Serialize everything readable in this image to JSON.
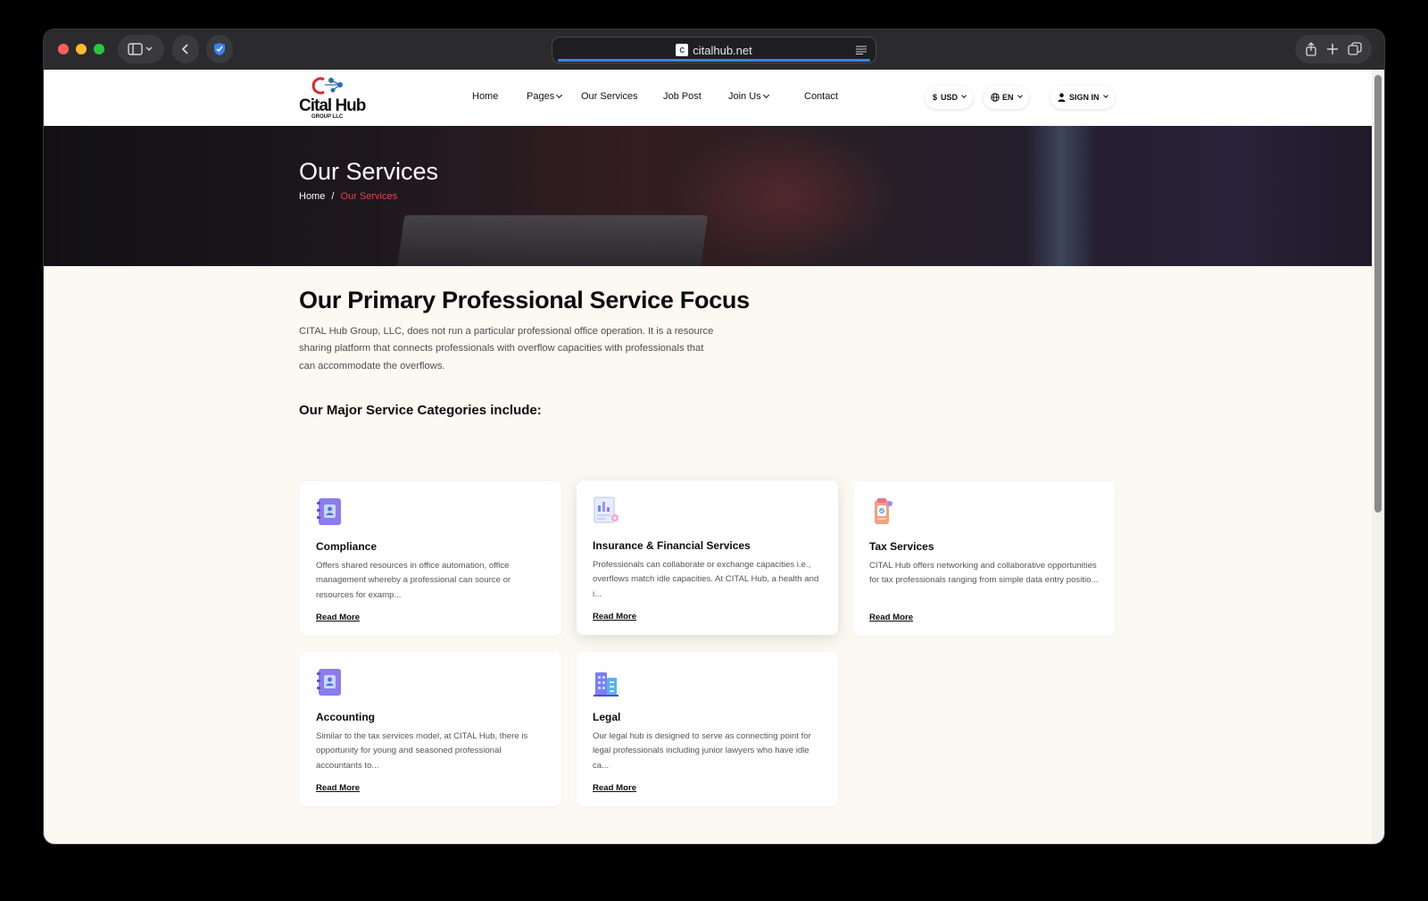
{
  "browser": {
    "url": "citalhub.net",
    "favicon_text": "C"
  },
  "header": {
    "logo_text": "Cital Hub",
    "logo_sub": "GROUP LLC",
    "nav": [
      "Home",
      "Pages",
      "Our Services",
      "Job Post",
      "Join Us",
      "Contact"
    ],
    "currency": "USD",
    "currency_symbol": "$",
    "language": "EN",
    "sign_in": "SIGN IN"
  },
  "hero": {
    "title": "Our Services",
    "breadcrumb_home": "Home",
    "breadcrumb_sep": "/",
    "breadcrumb_current": "Our Services"
  },
  "main": {
    "title": "Our Primary Professional Service Focus",
    "description": "CITAL Hub Group, LLC, does not run a particular professional office operation. It is a resource sharing platform that connects professionals with overflow capacities with professionals that can accommodate the overflows.",
    "subtitle": "Our Major Service Categories include:",
    "read_more": "Read More",
    "cards": [
      {
        "title": "Compliance",
        "desc": "Offers shared resources in office automation, office management whereby a professional can source or resources for examp...",
        "icon": "binder-icon"
      },
      {
        "title": "Insurance & Financial Services",
        "desc": "Professionals can collaborate or exchange capacities i.e., overflows match idle capacities. At CITAL Hub, a health and i...",
        "icon": "report-chart-icon"
      },
      {
        "title": "Tax Services",
        "desc": "CITAL Hub offers networking and collaborative opportunities for tax professionals ranging from simple data entry positio...",
        "icon": "tax-document-icon"
      },
      {
        "title": "Accounting",
        "desc": "Similar to the tax services model, at CITAL Hub, there is opportunity for young and seasoned professional accountants to...",
        "icon": "binder-icon"
      },
      {
        "title": "Legal",
        "desc": "Our legal hub is designed to serve as connecting point for legal professionals including junior lawyers who have idle ca...",
        "icon": "building-icon"
      }
    ]
  }
}
